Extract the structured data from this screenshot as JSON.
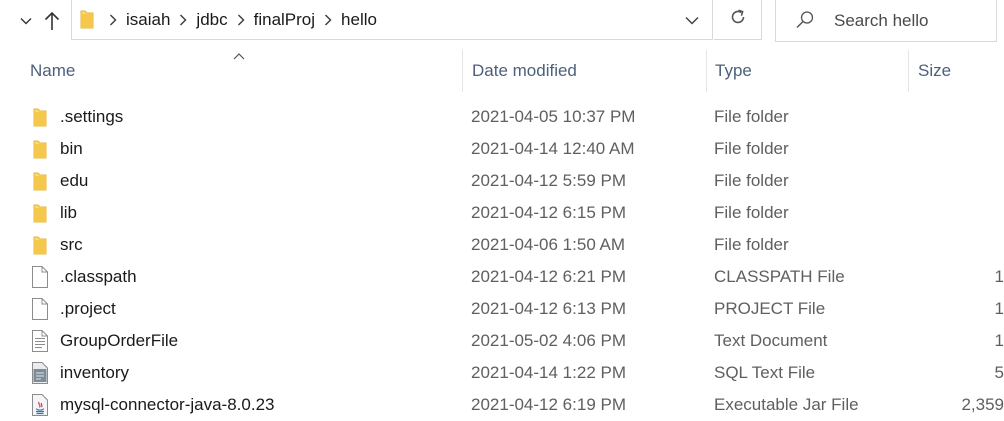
{
  "address_bar": {
    "breadcrumbs": [
      "isaiah",
      "jdbc",
      "finalProj",
      "hello"
    ]
  },
  "search": {
    "placeholder": "Search hello"
  },
  "columns": {
    "name": "Name",
    "date_modified": "Date modified",
    "type": "Type",
    "size": "Size"
  },
  "files": [
    {
      "name": ".settings",
      "date": "2021-04-05 10:37 PM",
      "type": "File folder",
      "size": "",
      "icon": "folder-icon"
    },
    {
      "name": "bin",
      "date": "2021-04-14 12:40 AM",
      "type": "File folder",
      "size": "",
      "icon": "folder-icon"
    },
    {
      "name": "edu",
      "date": "2021-04-12 5:59 PM",
      "type": "File folder",
      "size": "",
      "icon": "folder-icon"
    },
    {
      "name": "lib",
      "date": "2021-04-12 6:15 PM",
      "type": "File folder",
      "size": "",
      "icon": "folder-icon"
    },
    {
      "name": "src",
      "date": "2021-04-06 1:50 AM",
      "type": "File folder",
      "size": "",
      "icon": "folder-icon"
    },
    {
      "name": ".classpath",
      "date": "2021-04-12 6:21 PM",
      "type": "CLASSPATH File",
      "size": "1",
      "icon": "blank-file-icon"
    },
    {
      "name": ".project",
      "date": "2021-04-12 6:13 PM",
      "type": "PROJECT File",
      "size": "1",
      "icon": "blank-file-icon"
    },
    {
      "name": "GroupOrderFile",
      "date": "2021-05-02 4:06 PM",
      "type": "Text Document",
      "size": "1",
      "icon": "text-file-icon"
    },
    {
      "name": "inventory",
      "date": "2021-04-14 1:22 PM",
      "type": "SQL Text File",
      "size": "5",
      "icon": "sql-file-icon"
    },
    {
      "name": "mysql-connector-java-8.0.23",
      "date": "2021-04-12 6:19 PM",
      "type": "Executable Jar File",
      "size": "2,359",
      "icon": "jar-file-icon"
    }
  ],
  "colors": {
    "folder": "#f8d775",
    "folder_dark": "#e6b53f",
    "header_text": "#4c607a",
    "secondary_text": "#5f5f5f"
  }
}
